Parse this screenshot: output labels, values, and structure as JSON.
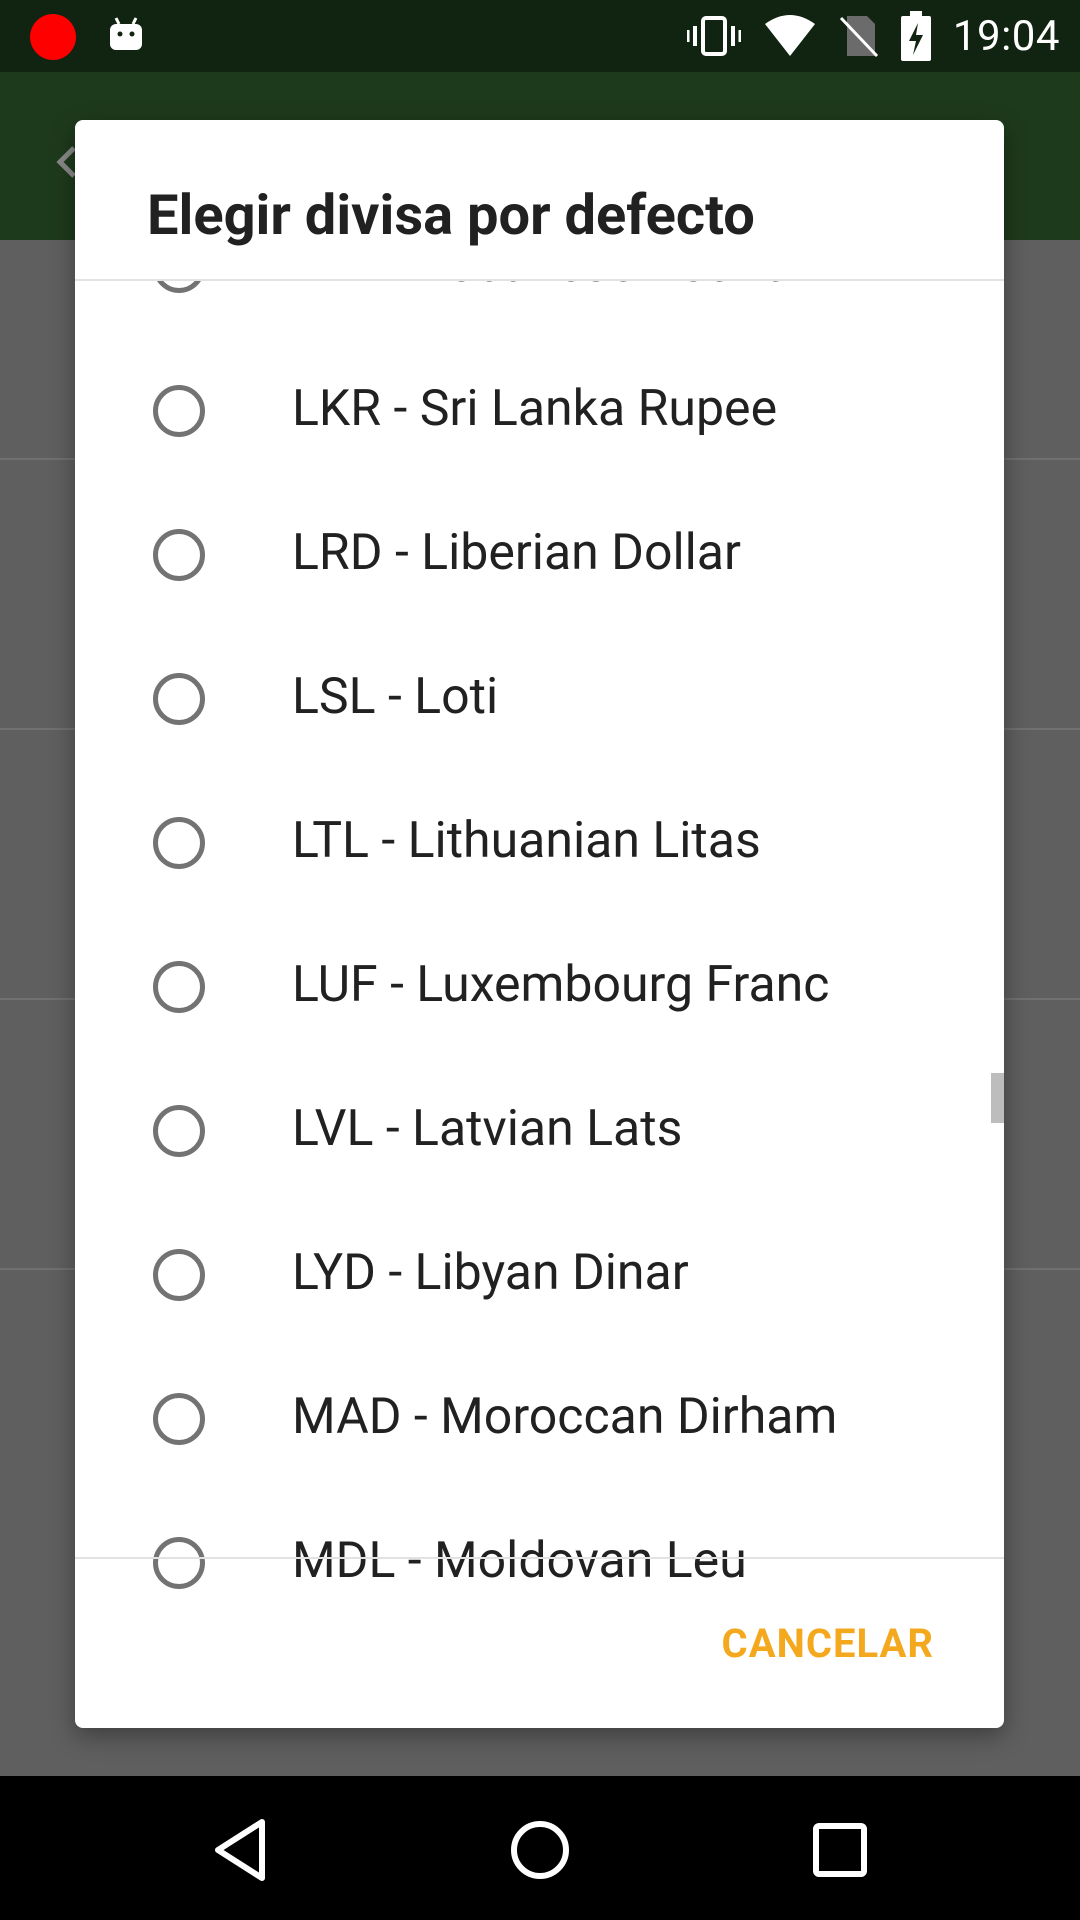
{
  "status_bar": {
    "time": "19:04"
  },
  "dialog": {
    "title": "Elegir divisa por defecto",
    "items": [
      {
        "label": "LBP - Lebanese Pound"
      },
      {
        "label": "LKR - Sri Lanka Rupee"
      },
      {
        "label": "LRD - Liberian Dollar"
      },
      {
        "label": "LSL - Loti"
      },
      {
        "label": "LTL - Lithuanian Litas"
      },
      {
        "label": "LUF - Luxembourg Franc"
      },
      {
        "label": "LVL - Latvian Lats"
      },
      {
        "label": "LYD - Libyan Dinar"
      },
      {
        "label": "MAD - Moroccan Dirham"
      },
      {
        "label": "MDL - Moldovan Leu"
      }
    ],
    "cancel_label": "CANCELAR"
  },
  "colors": {
    "status_bar": "#112311",
    "app_bar": "#1e3a1c",
    "accent": "#f4a81d",
    "radio_border": "#737373"
  }
}
